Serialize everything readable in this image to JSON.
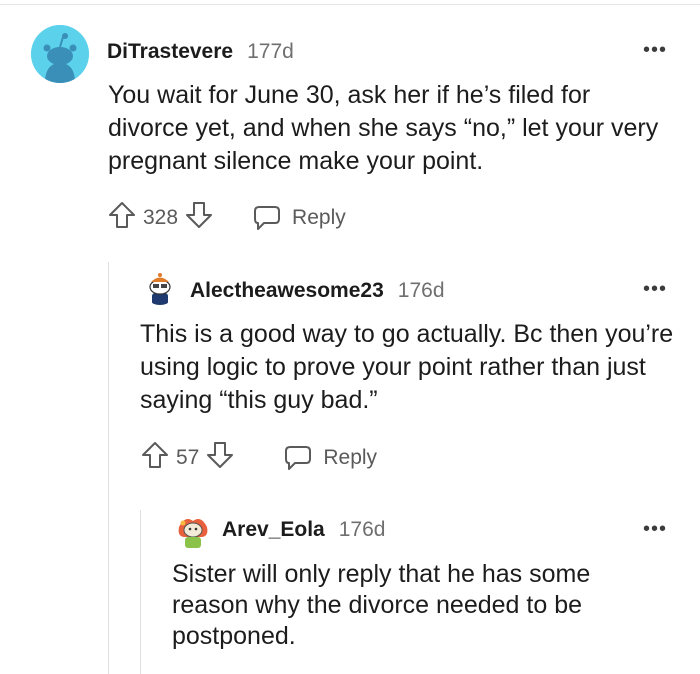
{
  "comments": [
    {
      "username": "DiTrastevere",
      "age": "177d",
      "body": "You wait for June 30, ask her if he’s filed for divorce yet, and when she says “no,” let your very pregnant silence make your point.",
      "score": "328",
      "reply_label": "Reply",
      "more_label": "•••"
    },
    {
      "username": "Alectheawesome23",
      "age": "176d",
      "body": "This is a good way to go actually. Bc then you’re using logic to prove your point rather than just saying “this guy bad.”",
      "score": "57",
      "reply_label": "Reply",
      "more_label": "•••"
    },
    {
      "username": "Arev_Eola",
      "age": "176d",
      "body": "Sister will only reply that he has some reason why the divorce needed to be postponed.",
      "more_label": "•••"
    }
  ],
  "icons": {
    "upvote": "arrow-up-outline-icon",
    "downvote": "arrow-down-outline-icon",
    "reply": "speech-bubble-icon",
    "more": "more-horizontal-icon"
  },
  "colors": {
    "default_avatar_bg": "#5bd1ec",
    "text": "#1c1c1c",
    "meta": "#6f6f6f",
    "thread_line": "#e0e0e0"
  }
}
